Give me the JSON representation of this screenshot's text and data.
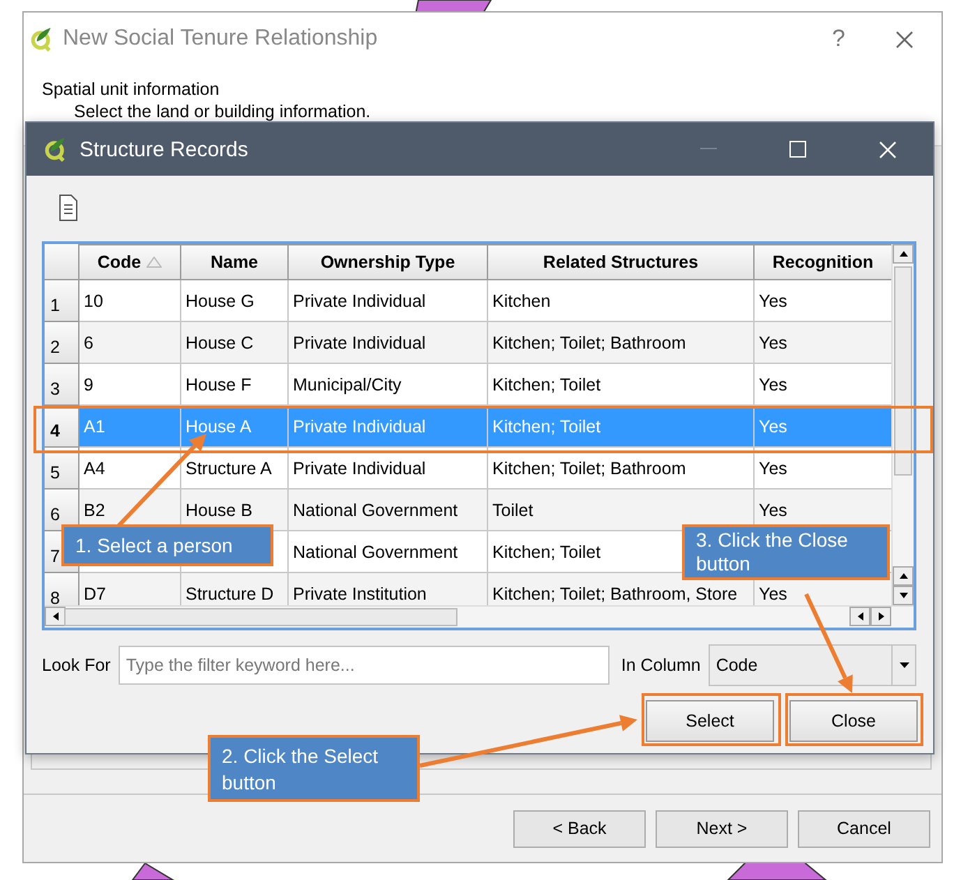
{
  "wizard": {
    "title": "New Social Tenure Relationship",
    "help": "?",
    "heading": "Spatial unit information",
    "description": "Select the land or building information.",
    "buttons": [
      "< Back",
      "Next >",
      "Cancel"
    ]
  },
  "dialog": {
    "title": "Structure Records",
    "columns": [
      {
        "label": "Code",
        "sorted": true
      },
      {
        "label": "Name",
        "sorted": false
      },
      {
        "label": "Ownership Type",
        "sorted": false
      },
      {
        "label": "Related Structures",
        "sorted": false
      },
      {
        "label": "Recognition",
        "sorted": false
      }
    ],
    "rows": [
      {
        "number": "1",
        "selected": false,
        "cells": [
          "10",
          "House G",
          "Private Individual",
          "Kitchen",
          "Yes"
        ]
      },
      {
        "number": "2",
        "selected": false,
        "cells": [
          "6",
          "House C",
          "Private Individual",
          "Kitchen; Toilet; Bathroom",
          "Yes"
        ]
      },
      {
        "number": "3",
        "selected": false,
        "cells": [
          "9",
          "House F",
          "Municipal/City",
          "Kitchen; Toilet",
          "Yes"
        ]
      },
      {
        "number": "4",
        "selected": true,
        "cells": [
          "A1",
          "House A",
          "Private Individual",
          "Kitchen; Toilet",
          "Yes"
        ]
      },
      {
        "number": "5",
        "selected": false,
        "cells": [
          "A4",
          "Structure A",
          "Private Individual",
          "Kitchen; Toilet; Bathroom",
          "Yes"
        ]
      },
      {
        "number": "6",
        "selected": false,
        "cells": [
          "B2",
          "House B",
          "National Government",
          "Toilet",
          "Yes"
        ]
      },
      {
        "number": "7",
        "selected": false,
        "cells": [
          null,
          null,
          "National Government",
          "Kitchen; Toilet",
          null
        ]
      },
      {
        "number": "8",
        "selected": false,
        "cells": [
          "D7",
          "Structure D",
          "Private Institution",
          "Kitchen; Toilet; Bathroom, Store",
          "Yes"
        ]
      }
    ],
    "filter": {
      "label": "Look For",
      "placeholder": "Type the filter keyword here...",
      "column_label": "In Column",
      "column_value": "Code"
    },
    "buttons": [
      "Select",
      "Close"
    ]
  },
  "callouts": [
    {
      "text": "1. Select a person"
    },
    {
      "text": "2. Click the Select button"
    },
    {
      "text": "3. Click the Close button"
    }
  ]
}
